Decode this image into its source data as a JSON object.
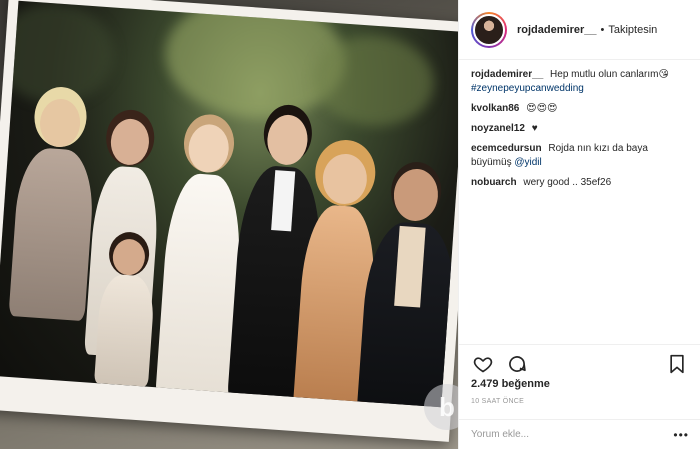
{
  "post": {
    "username": "rojdademirer__",
    "dot": "•",
    "follow_status": "Takiptesin"
  },
  "caption": {
    "username": "rojdademirer__",
    "text": "Hep mutlu olun canlarım",
    "emoji": "😘",
    "hashtag": "#zeynepeyupcanwedding"
  },
  "comments": [
    {
      "username": "kvolkan86",
      "text": "😍😍😍"
    },
    {
      "username": "noyzanel12",
      "text": "♥"
    },
    {
      "username": "ecemcedursun",
      "text": "Rojda nın kızı da baya büyümüş ",
      "mention": "@yidil"
    },
    {
      "username": "nobuarch",
      "text": "wery good .. 35ef26"
    }
  ],
  "likes": "2.479 beğenme",
  "timestamp": "10 SAAT ÖNCE",
  "add_comment_placeholder": "Yorum ekle...",
  "more_label": "•••",
  "watermark": "b",
  "icons": [
    "heart-icon",
    "comment-icon",
    "bookmark-icon",
    "more-options-icon"
  ],
  "colors": {
    "link": "#003569",
    "text": "#262626",
    "muted": "#999999",
    "border": "#efefef"
  }
}
